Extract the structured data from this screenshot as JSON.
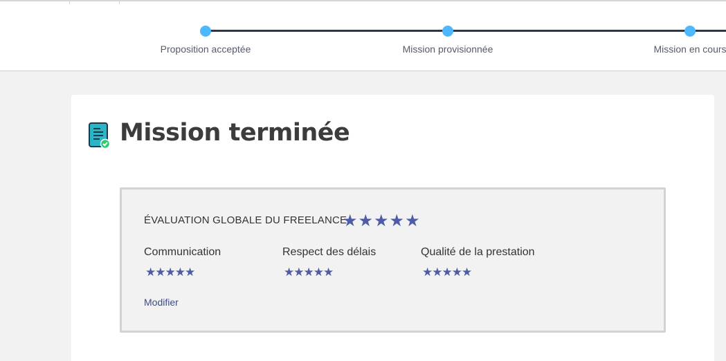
{
  "stepper": {
    "steps": [
      {
        "label": "Proposition acceptée"
      },
      {
        "label": "Mission provisionnée"
      },
      {
        "label": "Mission en cours"
      }
    ],
    "colors": {
      "dot": "#4db8ff",
      "line": "#2d3553"
    }
  },
  "section": {
    "title": "Mission terminée",
    "icon": "document-check-icon"
  },
  "evaluation": {
    "global_label": "ÉVALUATION GLOBALE DU FREELANCE",
    "global_rating": 5,
    "star_glyphs": "★★★★★",
    "criteria": [
      {
        "label": "Communication",
        "rating": 5
      },
      {
        "label": "Respect des délais",
        "rating": 5
      },
      {
        "label": "Qualité de la prestation",
        "rating": 5
      }
    ],
    "modify_label": "Modifier",
    "star_color": "#4f5ba6"
  }
}
